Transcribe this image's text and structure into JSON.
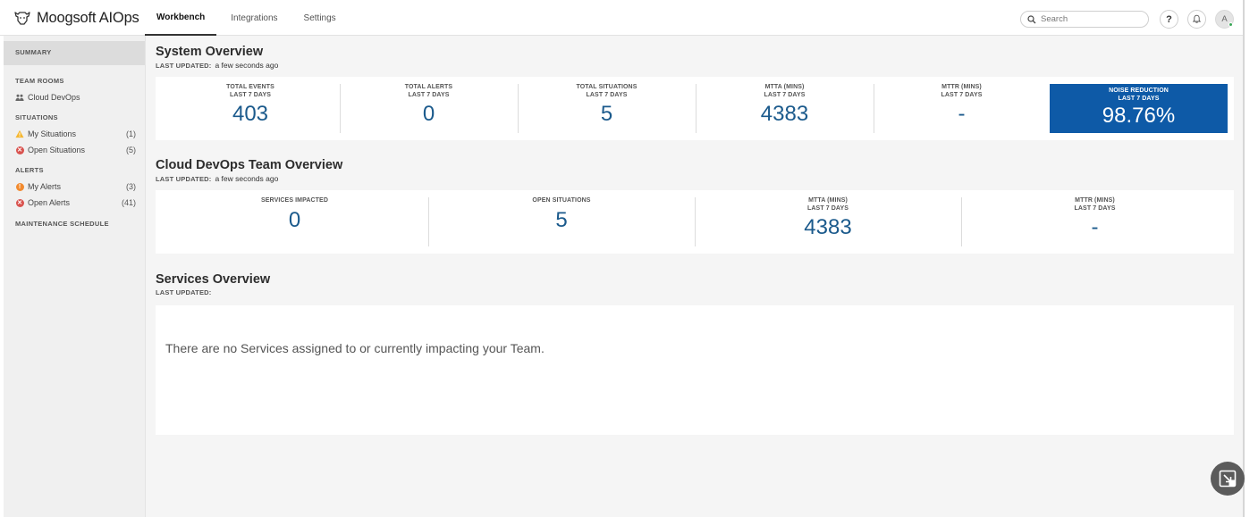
{
  "brand": {
    "name": "Moogsoft AIOps"
  },
  "nav": {
    "tabs": [
      "Workbench",
      "Integrations",
      "Settings"
    ],
    "active": "Workbench"
  },
  "search": {
    "placeholder": "Search"
  },
  "header": {
    "help_label": "?",
    "avatar_initial": "A"
  },
  "sidebar": {
    "summary": "SUMMARY",
    "team_rooms_head": "TEAM ROOMS",
    "team_room": "Cloud DevOps",
    "situations_head": "SITUATIONS",
    "my_situations": {
      "label": "My Situations",
      "count": "(1)"
    },
    "open_situations": {
      "label": "Open Situations",
      "count": "(5)"
    },
    "alerts_head": "ALERTS",
    "my_alerts": {
      "label": "My Alerts",
      "count": "(3)"
    },
    "open_alerts": {
      "label": "Open Alerts",
      "count": "(41)"
    },
    "maintenance_head": "MAINTENANCE SCHEDULE"
  },
  "system_overview": {
    "title": "System Overview",
    "updated_label": "LAST UPDATED:",
    "updated_value": "a few seconds ago",
    "metrics": [
      {
        "label": "TOTAL EVENTS",
        "period": "LAST 7 DAYS",
        "value": "403"
      },
      {
        "label": "TOTAL ALERTS",
        "period": "LAST 7 DAYS",
        "value": "0"
      },
      {
        "label": "TOTAL SITUATIONS",
        "period": "LAST 7 DAYS",
        "value": "5"
      },
      {
        "label": "MTTA (MINS)",
        "period": "LAST 7 DAYS",
        "value": "4383"
      },
      {
        "label": "MTTR (MINS)",
        "period": "LAST 7 DAYS",
        "value": "-"
      },
      {
        "label": "NOISE REDUCTION",
        "period": "LAST 7 DAYS",
        "value": "98.76%"
      }
    ]
  },
  "team_overview": {
    "title": "Cloud DevOps Team Overview",
    "updated_label": "LAST UPDATED:",
    "updated_value": "a few seconds ago",
    "metrics": [
      {
        "label": "SERVICES IMPACTED",
        "period": "",
        "value": "0"
      },
      {
        "label": "OPEN SITUATIONS",
        "period": "",
        "value": "5"
      },
      {
        "label": "MTTA (MINS)",
        "period": "LAST 7 DAYS",
        "value": "4383"
      },
      {
        "label": "MTTR (MINS)",
        "period": "LAST 7 DAYS",
        "value": "-"
      }
    ]
  },
  "services_overview": {
    "title": "Services Overview",
    "updated_label": "LAST UPDATED:",
    "message": "There are no Services assigned to or currently impacting your Team."
  },
  "colors": {
    "accent": "#0e5aa7",
    "metric_value": "#1b5a8c",
    "error": "#d9534f",
    "warning": "#f28a2e"
  }
}
